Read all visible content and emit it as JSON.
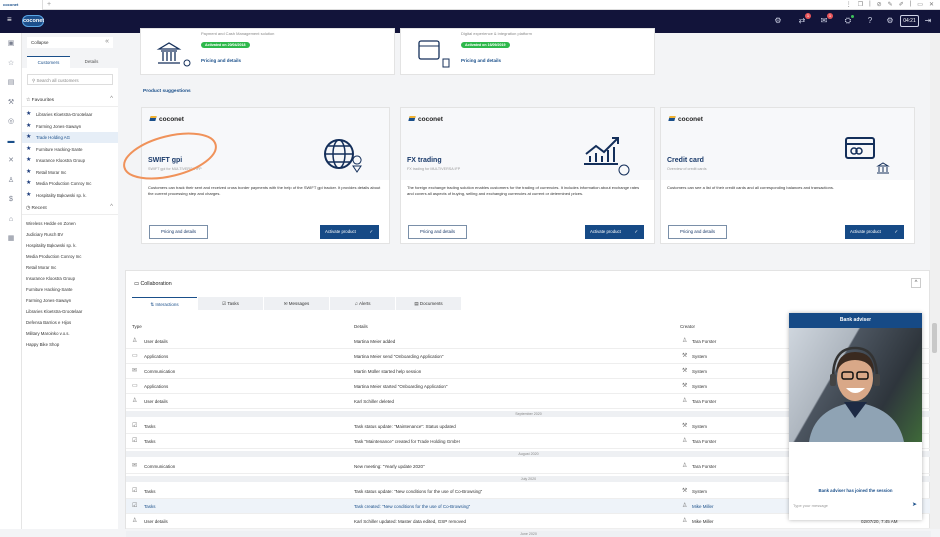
{
  "browser": {
    "tab_label": "coconet",
    "new_tab": "+",
    "controls": [
      "⋮",
      "❐",
      "|",
      "⊘",
      "✎",
      "✐",
      "|",
      "▭",
      "✕"
    ]
  },
  "topbar": {
    "logo": "coconet",
    "menu_icon": "≡",
    "icons": [
      {
        "name": "cobrowse-icon",
        "glyph": "⚙"
      },
      {
        "name": "transfer-icon",
        "glyph": "⇄",
        "badge": "1"
      },
      {
        "name": "messages-icon",
        "glyph": "✉",
        "badge": "1"
      },
      {
        "name": "status-icon",
        "glyph": "⛭",
        "dot": true
      },
      {
        "name": "help-icon",
        "glyph": "?"
      },
      {
        "name": "settings-icon",
        "glyph": "⚙"
      }
    ],
    "timer": "04:21",
    "logout_icon": "⇥"
  },
  "rail": [
    "▣",
    "☆",
    "▤",
    "⚒",
    "◎",
    "▬",
    "✕",
    "♙",
    "$",
    "⌂",
    "▦"
  ],
  "sidebar": {
    "collapse": "Collapse",
    "collapse_icon": "«",
    "tabs": [
      "Customers",
      "Details"
    ],
    "search_placeholder": "Search all customers",
    "favourites_label": "Favourites",
    "favourites": [
      "Libraries Kloetstra-Grootelaar",
      "Farming Jones-Sawayn",
      "Trade Holding AG",
      "Furniture Hacking-Sante",
      "Insurance Kloostra Group",
      "Retail Morar Inc",
      "Media Production Conroy Inc",
      "Hospitality Bąkowski sp. k."
    ],
    "recent_label": "Recent",
    "recent": [
      "Wireless Hedde en Zonen",
      "Judiciary Rusch BV",
      "Hospitality Bąkowski sp. k.",
      "Media Production Conroy Inc",
      "Retail Morar Inc",
      "Insurance Kloostra Group",
      "Furniture Hacking-Sante",
      "Farming Jones-Sawayn",
      "Libraries Kloetstra-Grootelaar",
      "Defensa Barrios e Hijos",
      "Military Maroinko v.o.s.",
      "Happy Bike Shop"
    ]
  },
  "active_products": [
    {
      "subtitle": "Payment and Cash Management solution",
      "badge": "Activated on 20/04/2018",
      "link": "Pricing and details"
    },
    {
      "subtitle": "Digital experience & integration platform",
      "badge": "Activated on 16/09/2019",
      "link": "Pricing and details"
    }
  ],
  "suggestions": {
    "title": "Product suggestions",
    "cards": [
      {
        "brand": "coconet",
        "title": "SWIFT gpi",
        "subtitle": "SWIFT gpi for MULTIVERSA IFP",
        "description": "Customers can track their sent and received cross border payments with the help of the SWIFT gpi tracker. It provides details about the current processing step and charges.",
        "pricing": "Pricing and details",
        "activate": "Activate product",
        "check": "✓"
      },
      {
        "brand": "coconet",
        "title": "FX trading",
        "subtitle": "FX trading for MULTIVERSA IFP",
        "description": "The foreign exchange trading solution enables customers for the trading of currencies. It includes information about exchange rates and covers all aspects of buying, selling and exchanging currencies at current or determined prices.",
        "pricing": "Pricing and details",
        "activate": "Activate product",
        "check": "✓"
      },
      {
        "brand": "coconet",
        "title": "Credit card",
        "subtitle": "Overview of credit cards",
        "description": "Customers can see a list of their credit cards and all corresponding balances and transactions.",
        "pricing": "Pricing and details",
        "activate": "Activate product",
        "check": "✓"
      }
    ]
  },
  "collab": {
    "title": "Collaboration",
    "toggle": "^",
    "tabs": [
      "Interactions",
      "Tasks",
      "Messages",
      "Alerts",
      "Documents"
    ],
    "tab_icons": [
      "⇅",
      "☑",
      "✉",
      "♫",
      "▤"
    ],
    "columns": [
      "Type",
      "Details",
      "Creator"
    ],
    "rows": [
      {
        "icon": "♙",
        "type": "User details",
        "details": "Martina Meier added",
        "creator": "Tara Forster",
        "cicon": "♙"
      },
      {
        "icon": "▭",
        "type": "Applications",
        "details": "Martina Meier send \"Onboarding Application\"",
        "creator": "System",
        "cicon": "⚒"
      },
      {
        "icon": "✉",
        "type": "Communication",
        "details": "Martin Müller started help session",
        "creator": "System",
        "cicon": "⚒"
      },
      {
        "icon": "▭",
        "type": "Applications",
        "details": "Martina Meier started \"Onboarding Application\"",
        "creator": "System",
        "cicon": "⚒"
      },
      {
        "icon": "♙",
        "type": "User details",
        "details": "Karl Schiller deleted",
        "creator": "Tara Forster",
        "cicon": "♙"
      },
      {
        "sep": "September 2020"
      },
      {
        "icon": "☑",
        "type": "Tasks",
        "details": "Task status update: \"Maintenance\": Status updated",
        "creator": "System",
        "cicon": "⚒"
      },
      {
        "icon": "☑",
        "type": "Tasks",
        "details": "Task \"Maintenance\" created for Trade Holding GmbH",
        "creator": "Tara Forster",
        "cicon": "♙"
      },
      {
        "sep": "August 2020"
      },
      {
        "icon": "✉",
        "type": "Communication",
        "details": "New meeting: \"Yearly update 2020\"",
        "creator": "Tara Forster",
        "cicon": "♙"
      },
      {
        "sep": "July 2020"
      },
      {
        "icon": "☑",
        "type": "Tasks",
        "details": "Task status update: \"New conditions for the use of Co-Browsing\"",
        "creator": "System",
        "cicon": "⚒"
      },
      {
        "icon": "☑",
        "type": "Tasks",
        "details": "Task created: \"New conditions for the use of Co-Browsing\"",
        "creator": "Mike Miller",
        "cicon": "♙",
        "selected": true
      },
      {
        "icon": "♙",
        "type": "User details",
        "details": "Karl Schiller updated: Master data edited, GSP removed",
        "creator": "Mike Miller",
        "cicon": "♙",
        "date": "02/07/20, 7:45 AM"
      },
      {
        "sep": "June 2020"
      }
    ]
  },
  "chat": {
    "title": "Bank adviser",
    "message": "Bank adviser has joined the session",
    "input_placeholder": "Type your message",
    "send_icon": "➤"
  },
  "colors": {
    "navy": "#12143a",
    "primary": "#164a86",
    "success": "#2eb84b",
    "badge": "#e8555a",
    "annotation": "#f0925a"
  }
}
